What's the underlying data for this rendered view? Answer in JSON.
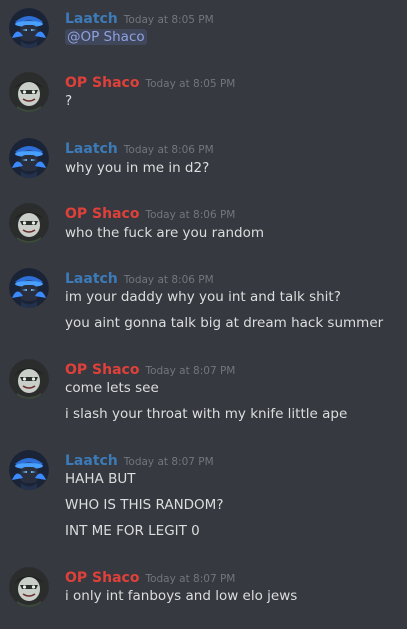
{
  "colors": {
    "background": "#36393f",
    "laatch_name": "#3d7ab8",
    "opshaco_name": "#e0403a",
    "timestamp": "#72767d",
    "message_text": "#dcddde",
    "mention_bg": "rgba(114,137,218,0.18)",
    "mention_text": "#8ea1e1"
  },
  "messages": [
    {
      "author": "Laatch",
      "avatar": "laatch-avatar",
      "time": "Today at 8:05 PM",
      "lines": [
        "@OP Shaco"
      ]
    },
    {
      "author": "OP Shaco",
      "avatar": "opshaco-avatar",
      "time": "Today at 8:05 PM",
      "lines": [
        "?"
      ]
    },
    {
      "author": "Laatch",
      "avatar": "laatch-avatar",
      "time": "Today at 8:06 PM",
      "lines": [
        "why you in me in d2?"
      ]
    },
    {
      "author": "OP Shaco",
      "avatar": "opshaco-avatar",
      "time": "Today at 8:06 PM",
      "lines": [
        "who the fuck are you random"
      ]
    },
    {
      "author": "Laatch",
      "avatar": "laatch-avatar",
      "time": "Today at 8:06 PM",
      "lines": [
        "im your daddy why you int and talk shit?",
        "you aint gonna talk big at dream hack summer"
      ]
    },
    {
      "author": "OP Shaco",
      "avatar": "opshaco-avatar",
      "time": "Today at 8:07 PM",
      "lines": [
        "come lets see",
        "i slash your throat with my knife little ape"
      ]
    },
    {
      "author": "Laatch",
      "avatar": "laatch-avatar",
      "time": "Today at 8:07 PM",
      "lines": [
        "HAHA BUT",
        "WHO IS THIS RANDOM?",
        "INT ME FOR LEGIT 0"
      ]
    },
    {
      "author": "OP Shaco",
      "avatar": "opshaco-avatar",
      "time": "Today at 8:07 PM",
      "lines": [
        "i only int fanboys and low elo jews"
      ]
    }
  ]
}
